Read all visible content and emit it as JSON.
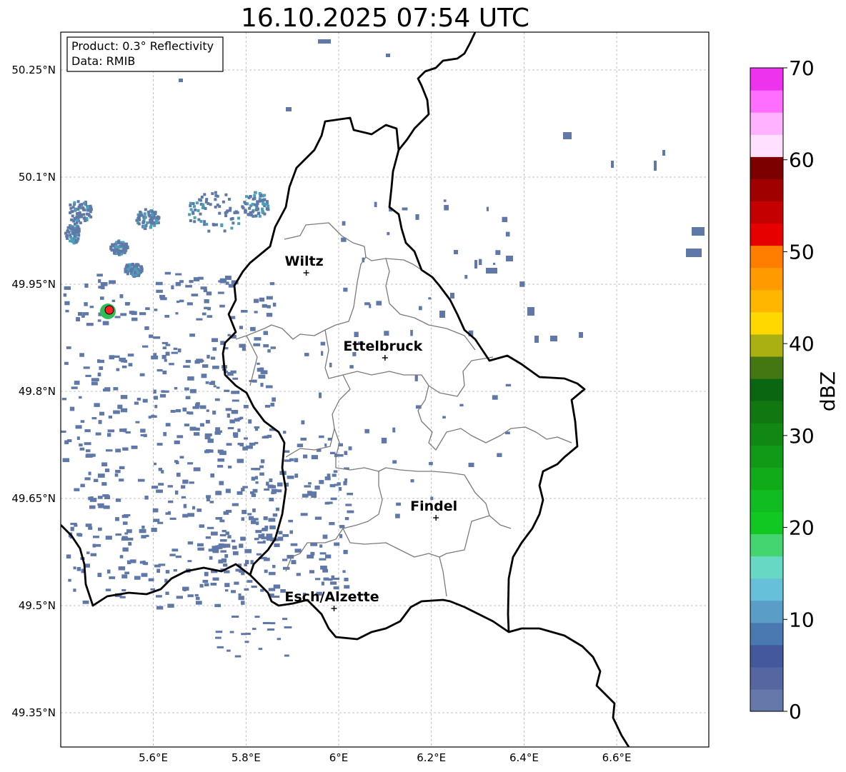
{
  "title": "16.10.2025 07:54 UTC",
  "info_box": {
    "product": "Product: 0.3° Reflectivity",
    "data_source": "Data: RMIB"
  },
  "map": {
    "lon_range": [
      5.4,
      6.8
    ],
    "lat_range": [
      49.3,
      50.3
    ],
    "lon_ticks": [
      {
        "value": 5.6,
        "label": "5.6°E"
      },
      {
        "value": 5.8,
        "label": "5.8°E"
      },
      {
        "value": 6.0,
        "label": "6°E"
      },
      {
        "value": 6.2,
        "label": "6.2°E"
      },
      {
        "value": 6.4,
        "label": "6.4°E"
      },
      {
        "value": 6.6,
        "label": "6.6°E"
      }
    ],
    "lat_ticks": [
      {
        "value": 50.25,
        "label": "50.25°N"
      },
      {
        "value": 50.1,
        "label": "50.1°N"
      },
      {
        "value": 49.95,
        "label": "49.95°N"
      },
      {
        "value": 49.8,
        "label": "49.8°N"
      },
      {
        "value": 49.65,
        "label": "49.65°N"
      },
      {
        "value": 49.5,
        "label": "49.5°N"
      },
      {
        "value": 49.35,
        "label": "49.35°N"
      }
    ],
    "grid": true,
    "cities": [
      {
        "name": "Wiltz",
        "lon": 5.93,
        "lat": 49.966
      },
      {
        "name": "Ettelbruck",
        "lon": 6.1,
        "lat": 49.847
      },
      {
        "name": "Findel",
        "lon": 6.21,
        "lat": 49.623
      },
      {
        "name": "Esch/Alzette",
        "lon": 5.99,
        "lat": 49.496
      }
    ],
    "radar_site": {
      "lon": 5.505,
      "lat": 49.914,
      "marker_color": "#ff2020"
    }
  },
  "colorbar": {
    "label": "dBZ",
    "min": 0,
    "max": 70,
    "tick_values": [
      0,
      10,
      20,
      30,
      40,
      50,
      60,
      70
    ],
    "tick_labels": [
      "0",
      "10",
      "20",
      "30",
      "40",
      "50",
      "60",
      "70"
    ],
    "colors": [
      "#6677aa",
      "#5566a0",
      "#44589e",
      "#4a78b0",
      "#5a9ec8",
      "#66c0da",
      "#66d8c4",
      "#44d470",
      "#11c822",
      "#11bb22",
      "#11aa18",
      "#119918",
      "#118814",
      "#117711",
      "#0b6611",
      "#447711",
      "#aab011",
      "#ffd800",
      "#ffb600",
      "#ff9a00",
      "#ff7e00",
      "#e60000",
      "#c40000",
      "#a00000",
      "#7c0000",
      "#ffe0ff",
      "#ffb2ff",
      "#ff6eff",
      "#ee33ee"
    ]
  },
  "echo_color": "#5f78a8"
}
